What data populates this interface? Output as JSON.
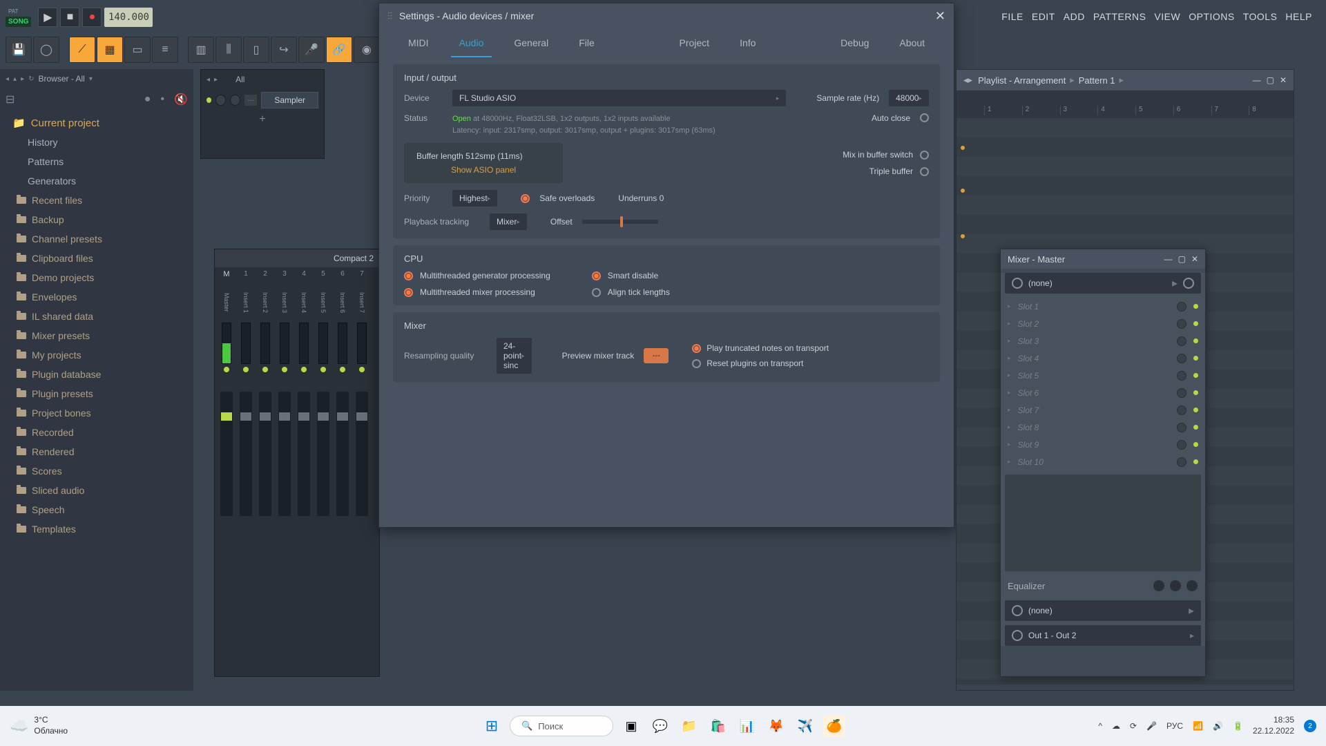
{
  "topbar": {
    "pat": "PAT",
    "song": "SONG",
    "tempo": "140.000"
  },
  "menu": [
    "FILE",
    "EDIT",
    "ADD",
    "PATTERNS",
    "VIEW",
    "OPTIONS",
    "TOOLS",
    "HELP"
  ],
  "browser": {
    "title": "Browser - All",
    "current": "Current project",
    "sub": [
      "History",
      "Patterns",
      "Generators"
    ],
    "folders": [
      "Recent files",
      "Backup",
      "Channel presets",
      "Clipboard files",
      "Demo projects",
      "Envelopes",
      "IL shared data",
      "Mixer presets",
      "My projects",
      "Plugin database",
      "Plugin presets",
      "Project bones",
      "Recorded",
      "Rendered",
      "Scores",
      "Sliced audio",
      "Speech",
      "Templates"
    ]
  },
  "channel": {
    "all": "All",
    "sampler": "Sampler"
  },
  "mixer_bg": {
    "compact": "Compact 2",
    "master_label": "Master",
    "inserts": [
      "Insert 1",
      "Insert 2",
      "Insert 3",
      "Insert 4",
      "Insert 5",
      "Insert 6",
      "Insert 7"
    ]
  },
  "settings": {
    "title": "Settings - Audio devices / mixer",
    "tabs": [
      "MIDI",
      "Audio",
      "General",
      "File",
      "Project",
      "Info",
      "Debug",
      "About"
    ],
    "active_tab": "Audio",
    "io_title": "Input / output",
    "device_label": "Device",
    "device_value": "FL Studio ASIO",
    "sample_rate_label": "Sample rate (Hz)",
    "sample_rate_value": "48000",
    "status_label": "Status",
    "status_open": "Open",
    "status_line1": " at 48000Hz, Float32LSB, 1x2 outputs, 1x2 inputs available",
    "status_line2": "Latency: input: 2317smp, output: 3017smp, output + plugins: 3017smp (63ms)",
    "auto_close": "Auto close",
    "buffer_length": "Buffer length 512smp (11ms)",
    "buffer_link": "Show ASIO panel",
    "mix_buffer": "Mix in buffer switch",
    "triple_buffer": "Triple buffer",
    "priority_label": "Priority",
    "priority_value": "Highest",
    "safe_overloads": "Safe overloads",
    "underruns_label": "Underruns 0",
    "playback_label": "Playback tracking",
    "playback_value": "Mixer",
    "offset_label": "Offset",
    "cpu_title": "CPU",
    "cpu_gen": "Multithreaded generator processing",
    "cpu_mixer": "Multithreaded mixer processing",
    "cpu_smart": "Smart disable",
    "cpu_tick": "Align tick lengths",
    "mixer_title": "Mixer",
    "resampling_label": "Resampling quality",
    "resampling_value": "24-point sinc",
    "preview_label": "Preview mixer track",
    "preview_value": "---",
    "play_truncated": "Play truncated notes on transport",
    "reset_plugins": "Reset plugins on transport"
  },
  "playlist": {
    "title": "Playlist - Arrangement",
    "pattern": "Pattern 1",
    "ticks": [
      "1",
      "2",
      "3",
      "4",
      "5",
      "6",
      "7",
      "8"
    ]
  },
  "mixer_master": {
    "title": "Mixer - Master",
    "none": "(none)",
    "slots": [
      "Slot 1",
      "Slot 2",
      "Slot 3",
      "Slot 4",
      "Slot 5",
      "Slot 6",
      "Slot 7",
      "Slot 8",
      "Slot 9",
      "Slot 10"
    ],
    "equalizer": "Equalizer",
    "output": "Out 1 - Out 2"
  },
  "taskbar": {
    "temp": "3°C",
    "weather": "Облачно",
    "search": "Поиск",
    "lang": "РУС",
    "time": "18:35",
    "date": "22.12.2022"
  }
}
